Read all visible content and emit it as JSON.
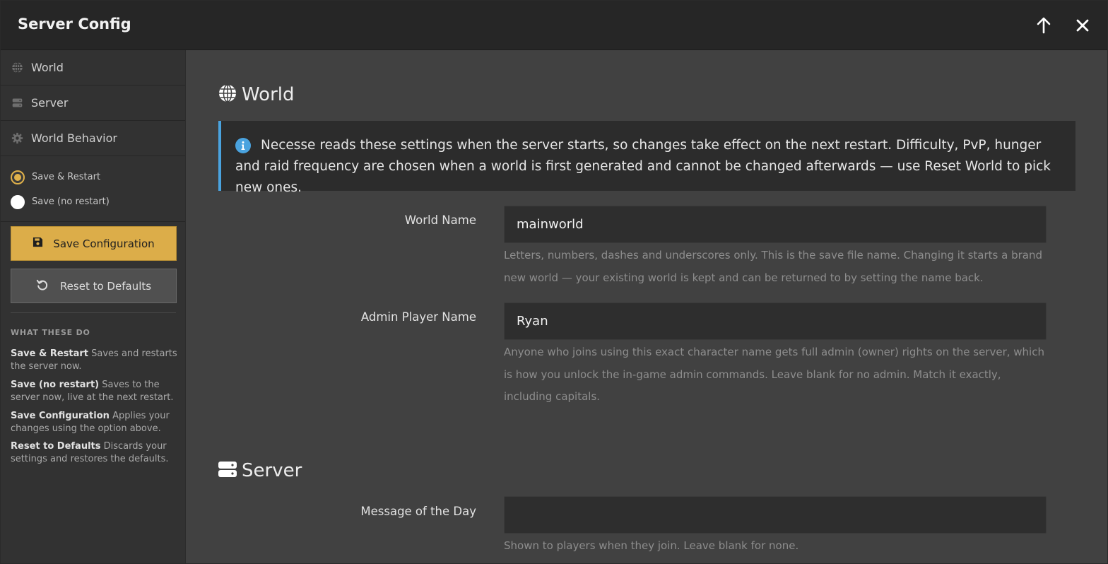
{
  "window": {
    "title": "Server Config",
    "colors": {
      "accent": "#dcad49",
      "info_border": "#4aa3df"
    }
  },
  "titlebar_buttons": {
    "up_icon": "arrow-up-icon",
    "close_icon": "close-icon"
  },
  "sidebar": {
    "nav": [
      {
        "label": "World",
        "icon": "globe-icon"
      },
      {
        "label": "Server",
        "icon": "server-icon"
      },
      {
        "label": "World Behavior",
        "icon": "gear-icon"
      }
    ],
    "save_mode": {
      "options": [
        "Save & Restart",
        "Save (no restart)"
      ],
      "selected": "Save & Restart"
    },
    "save_button": "Save Configuration",
    "reset_button": "Reset to Defaults",
    "help_heading": "WHAT THESE DO",
    "help": [
      {
        "term": "Save & Restart",
        "desc": "Saves and restarts the server now."
      },
      {
        "term": "Save (no restart)",
        "desc": "Saves to the server now, live at the next restart."
      },
      {
        "term": "Save Configuration",
        "desc": "Applies your changes using the option above."
      },
      {
        "term": "Reset to Defaults",
        "desc": "Discards your settings and restores the defaults."
      }
    ]
  },
  "main": {
    "world_section": {
      "title": "World",
      "info": "Necesse reads these settings when the server starts, so changes take effect on the next restart. Difficulty, PvP, hunger and raid frequency are chosen when a world is first generated and cannot be changed afterwards — use Reset World to pick new ones.",
      "fields": [
        {
          "label": "World Name",
          "value": "mainworld",
          "help": "Letters, numbers, dashes and underscores only. This is the save file name. Changing it starts a brand new world — your existing world is kept and can be returned to by setting the name back."
        },
        {
          "label": "Admin Player Name",
          "value": "Ryan",
          "help": "Anyone who joins using this exact character name gets full admin (owner) rights on the server, which is how you unlock the in-game admin commands. Leave blank for no admin. Match it exactly, including capitals."
        }
      ]
    },
    "server_section": {
      "title": "Server",
      "fields": [
        {
          "label": "Message of the Day",
          "value": "",
          "help": "Shown to players when they join. Leave blank for none."
        }
      ]
    }
  }
}
